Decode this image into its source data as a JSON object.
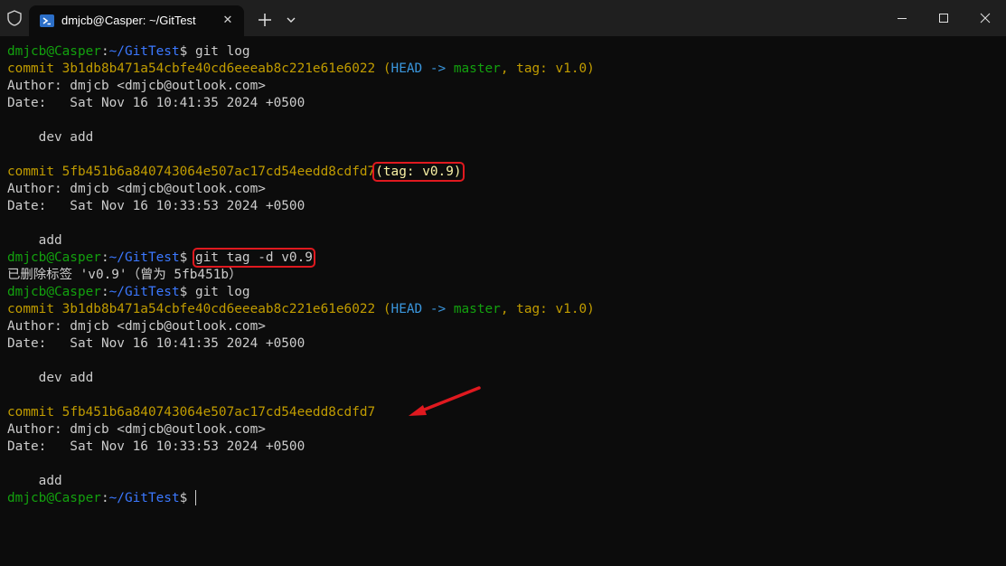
{
  "window": {
    "tab_title": "dmjcb@Casper: ~/GitTest",
    "close_glyph": "✕",
    "new_tab_glyph": "+",
    "dropdown_glyph": "⌄"
  },
  "prompt": {
    "user": "dmjcb@Casper",
    "sep": ":",
    "path": "~/GitTest",
    "dollar": "$ "
  },
  "commands": {
    "log": "git log",
    "tag_delete": "git tag -d v0.9"
  },
  "commits": {
    "head": {
      "label": "commit ",
      "hash": "3b1db8b471a54cbfe40cd6eeeab8c221e61e6022",
      "ref_open": " (",
      "head_ref": "HEAD -> ",
      "branch": "master",
      "comma": ", ",
      "tag_ref": "tag: v1.0",
      "ref_close": ")",
      "author": "Author: dmjcb <dmjcb@outlook.com>",
      "date": "Date:   Sat Nov 16 10:41:35 2024 +0500",
      "message": "    dev add"
    },
    "tagged": {
      "label": "commit ",
      "hash": "5fb451b6a840743064e507ac17cd54eedd8cdfd7",
      "ref": "(tag: v0.9)",
      "author": "Author: dmjcb <dmjcb@outlook.com>",
      "date": "Date:   Sat Nov 16 10:33:53 2024 +0500",
      "message": "    add"
    }
  },
  "output": {
    "tag_deleted": "已删除标签 'v0.9'（曾为 5fb451b）"
  },
  "colors": {
    "prompt_user": "#13a10e",
    "prompt_path": "#3b78ff",
    "commit_hash": "#c19c00",
    "head_ref": "#3a96dd",
    "branch": "#13a10e",
    "highlight": "#e0191f"
  }
}
